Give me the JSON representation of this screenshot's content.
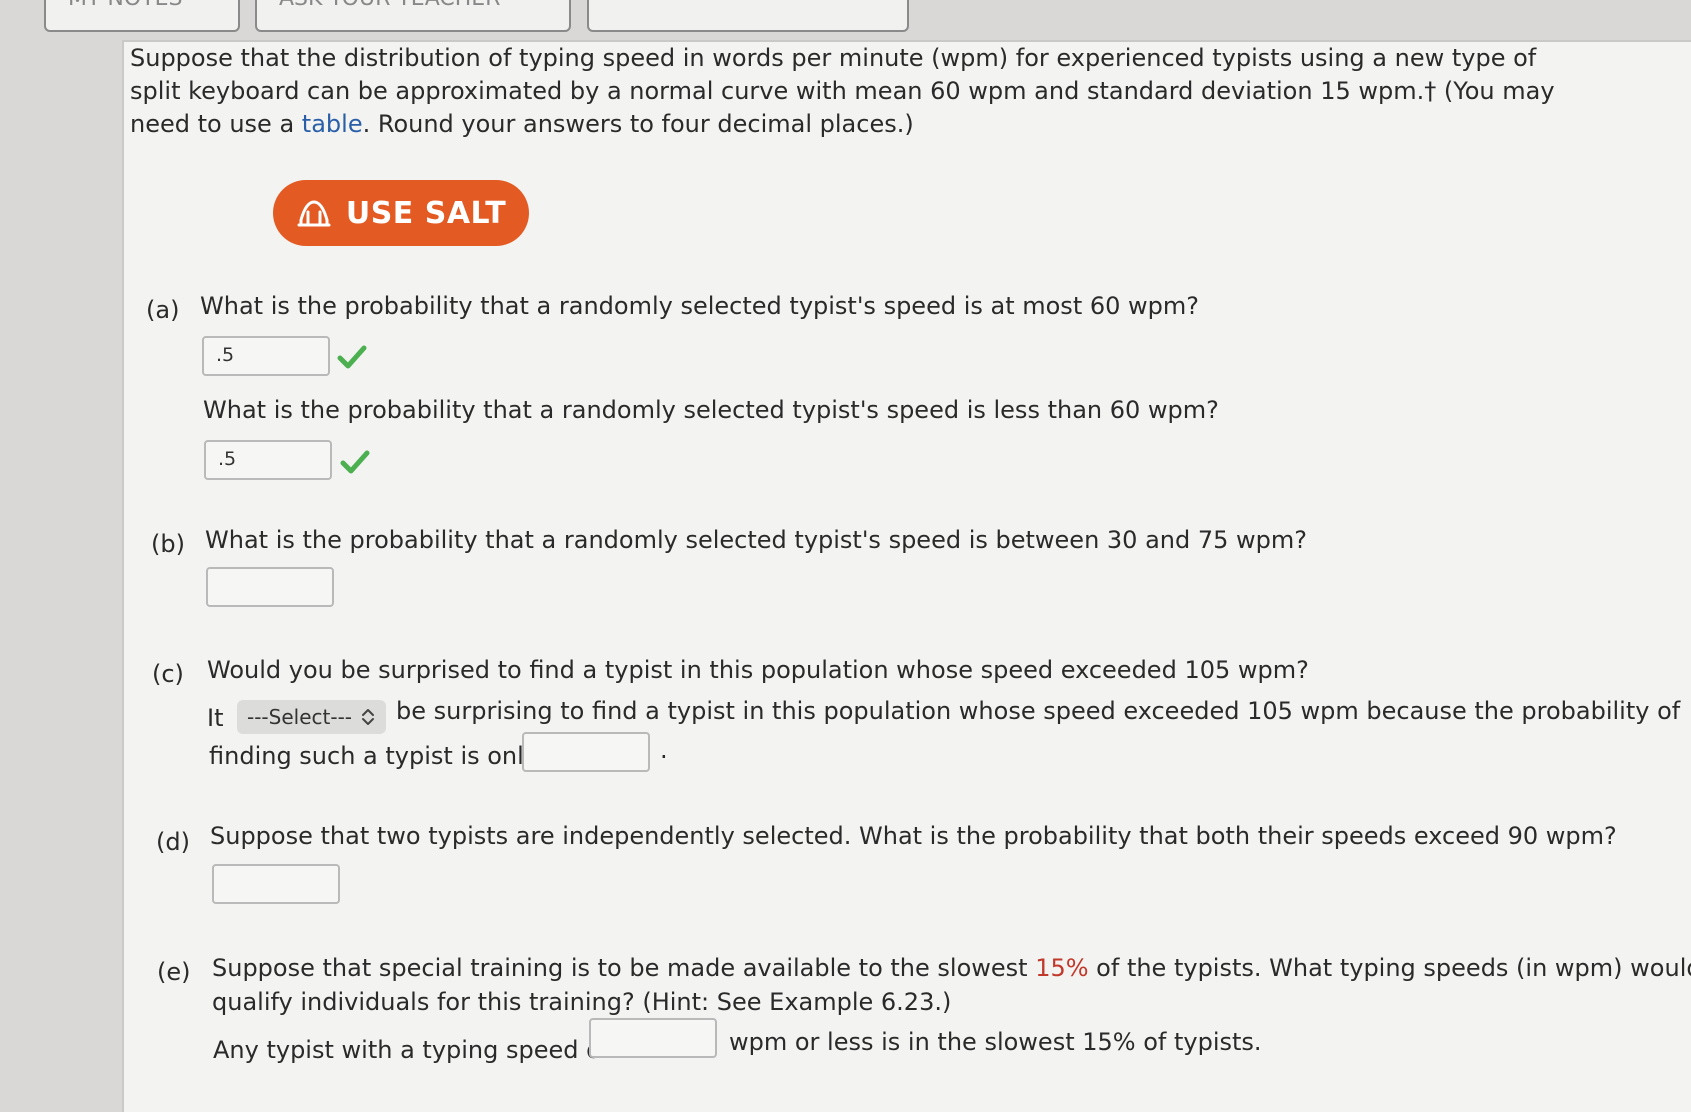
{
  "top_buttons": [
    "MY NOTES",
    "ASK YOUR TEACHER",
    ""
  ],
  "intro": {
    "text": "Suppose that the distribution of typing speed in words per minute (wpm) for experienced typists using a new type of split keyboard can be approximated by a normal curve with mean 60 wpm and standard deviation 15 wpm.† (You may need to use a",
    "link": "table",
    "tail": ". Round your answers to four decimal places.)"
  },
  "salt_button": {
    "label": "USE SALT",
    "icon": "salt-icon",
    "color": "#e35a22"
  },
  "parts": {
    "a": {
      "letter": "(a)",
      "question1": "What is the probability that a randomly selected typist's speed is at most 60 wpm?",
      "answer1": ".5",
      "question2": "What is the probability that a randomly selected typist's speed is less than 60 wpm?",
      "answer2": ".5"
    },
    "b": {
      "letter": "(b)",
      "question": "What is the probability that a randomly selected typist's speed is between 30 and 75 wpm?",
      "answer": ""
    },
    "c": {
      "letter": "(c)",
      "question": "Would you be surprised to find a typist in this population whose speed exceeded 105 wpm?",
      "sentence_start": "It",
      "select_value": "---Select---",
      "sentence_mid": "be surprising to find a typist in this population whose speed exceeded 105 wpm because the probability of",
      "sentence_end": "finding such a typist is only",
      "period": ".",
      "answer": ""
    },
    "d": {
      "letter": "(d)",
      "question": "Suppose that two typists are independently selected. What is the probability that both their speeds exceed 90 wpm?",
      "answer": ""
    },
    "e": {
      "letter": "(e)",
      "question_pre": "Suppose that special training is to be made available to the slowest ",
      "question_pct": "15%",
      "question_post": " of the typists. What typing speeds (in wpm) would",
      "question_line2": "qualify individuals for this training? (Hint: See Example 6.23.)",
      "answer_pre": "Any typist with a typing speed of",
      "answer_post": "wpm or less is in the slowest 15% of typists.",
      "answer": ""
    }
  },
  "colors": {
    "check": "#4caf50",
    "highlight": "#c0392b",
    "link": "#2a5fa8"
  }
}
